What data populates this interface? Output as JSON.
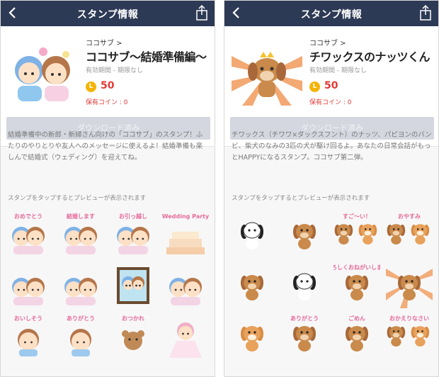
{
  "left": {
    "nav": {
      "title": "スタンプ情報"
    },
    "creator": "ココサブ >",
    "title": "ココサブ〜結婚準備編〜",
    "period": "有効期間 - 期限なし",
    "coin_label": "L",
    "price": "50",
    "owned": "保有コイン : 0",
    "button": "ダウンロード済み",
    "description": "結婚準備中の新郎・新婦さん向けの「ココサブ」のスタンプ！ふたりのやりとりや友人へのメッセージに使えるよ！結婚準備も楽しんで結婚式（ウェディング）を迎えてね。",
    "hint": "スタンプをタップするとプレビューが表示されます",
    "stickers": [
      {
        "name": "sticker-1",
        "text": "おめでとう",
        "theme": "couple"
      },
      {
        "name": "sticker-2",
        "text": "結婚します",
        "theme": "couple"
      },
      {
        "name": "sticker-3",
        "text": "お引っ越し",
        "theme": "couple"
      },
      {
        "name": "sticker-4",
        "text": "Wedding Party",
        "theme": "cake"
      },
      {
        "name": "sticker-5",
        "text": "",
        "theme": "couple"
      },
      {
        "name": "sticker-6",
        "text": "",
        "theme": "couple"
      },
      {
        "name": "sticker-7",
        "text": "",
        "theme": "frame"
      },
      {
        "name": "sticker-8",
        "text": "",
        "theme": "couple"
      },
      {
        "name": "sticker-9",
        "text": "おいしそう",
        "theme": "single"
      },
      {
        "name": "sticker-10",
        "text": "ありがとう",
        "theme": "single"
      },
      {
        "name": "sticker-11",
        "text": "おつかれ",
        "theme": "bear"
      },
      {
        "name": "sticker-12",
        "text": "",
        "theme": "dress"
      }
    ]
  },
  "right": {
    "nav": {
      "title": "スタンプ情報"
    },
    "creator": "ココサブ >",
    "title": "チワックスのナッツくん",
    "period": "有効期間 - 期限なし",
    "coin_label": "L",
    "price": "50",
    "owned": "保有コイン : 0",
    "button": "ダウンロード済み",
    "description": "チワックス（チワワ×ダックスフント）のナッツ、パピヨンのバンビ、柴犬のなみの3匹の犬が駆け回るよ。あなたの日常会話がもっとHAPPYになるスタンプ。ココサブ第二弾。",
    "hint": "スタンプをタップするとプレビューが表示されます",
    "stickers": [
      {
        "name": "sticker-1",
        "text": "",
        "theme": "dog-bw"
      },
      {
        "name": "sticker-2",
        "text": "",
        "theme": "dog-brown"
      },
      {
        "name": "sticker-3",
        "text": "すご〜い！",
        "theme": "dogs"
      },
      {
        "name": "sticker-4",
        "text": "おやすみ",
        "theme": "dogs"
      },
      {
        "name": "sticker-5",
        "text": "",
        "theme": "dog-brown"
      },
      {
        "name": "sticker-6",
        "text": "",
        "theme": "dog-bw"
      },
      {
        "name": "sticker-7",
        "text": "よろしくおねがいします",
        "theme": "dog-brown"
      },
      {
        "name": "sticker-8",
        "text": "",
        "theme": "dog-rays"
      },
      {
        "name": "sticker-9",
        "text": "",
        "theme": "dog-shiba"
      },
      {
        "name": "sticker-10",
        "text": "ありがとう",
        "theme": "dog-brown"
      },
      {
        "name": "sticker-11",
        "text": "ごめん",
        "theme": "dog-brown"
      },
      {
        "name": "sticker-12",
        "text": "おかえりなさい",
        "theme": "dogs"
      }
    ]
  },
  "colors": {
    "navbar": "#2d3a55",
    "price": "#e53935",
    "coin": "#f4b400",
    "button_disabled": "#d4d7df"
  }
}
